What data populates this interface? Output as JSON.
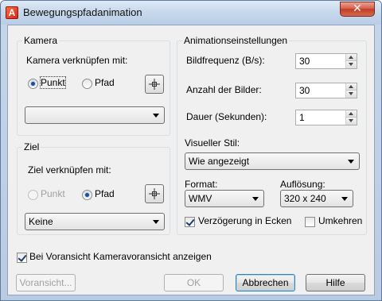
{
  "window": {
    "title": "Bewegungspfadanimation",
    "close_glyph": "✕",
    "app_icon_letter": "A"
  },
  "camera": {
    "group_label": "Kamera",
    "link_label": "Kamera verknüpfen mit:",
    "radio_point": "Punkt",
    "radio_path": "Pfad",
    "selected": "Punkt",
    "combo_value": ""
  },
  "target": {
    "group_label": "Ziel",
    "link_label": "Ziel verknüpfen mit:",
    "radio_point": "Punkt",
    "radio_path": "Pfad",
    "selected": "Pfad",
    "combo_value": "Keine"
  },
  "animation": {
    "group_label": "Animationseinstellungen",
    "framerate_label": "Bildfrequenz (B/s):",
    "framerate_value": "30",
    "frames_label": "Anzahl der Bilder:",
    "frames_value": "30",
    "duration_label": "Dauer (Sekunden):",
    "duration_value": "1",
    "visual_style_label": "Visueller Stil:",
    "visual_style_value": "Wie angezeigt",
    "format_label": "Format:",
    "format_value": "WMV",
    "resolution_label": "Auflösung:",
    "resolution_value": "320 x 240",
    "corner_delay_label": "Verzögerung in Ecken",
    "corner_delay_checked": true,
    "reverse_label": "Umkehren",
    "reverse_checked": false
  },
  "preview_checkbox": {
    "label": "Bei Voransicht Kameravoransicht anzeigen",
    "checked": true
  },
  "buttons": {
    "preview": "Voransicht...",
    "ok": "OK",
    "cancel": "Abbrechen",
    "help": "Hilfe"
  },
  "icons": {
    "pick_point": "crosshair-pick-icon",
    "dropdown": "chevron-down-icon"
  }
}
